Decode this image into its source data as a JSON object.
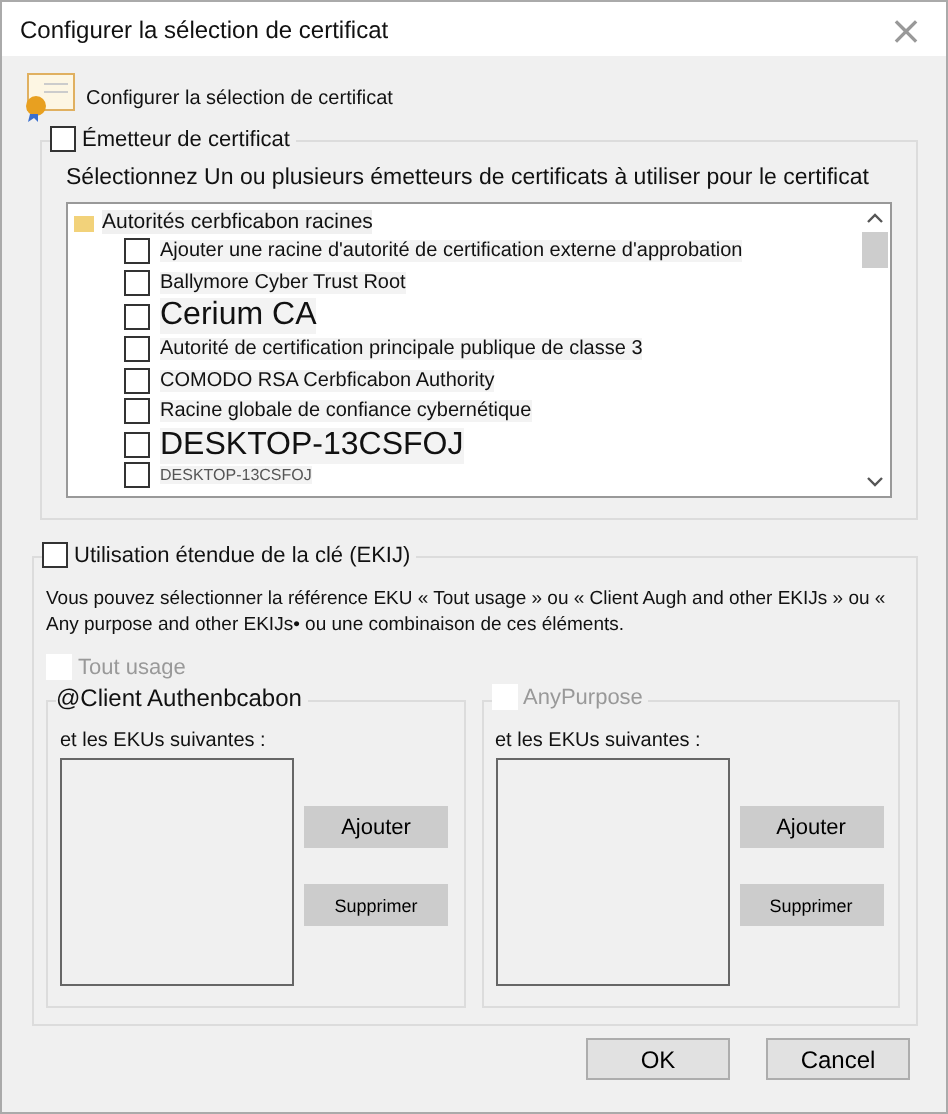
{
  "window": {
    "title": "Configurer la sélection de certificat",
    "close": "×"
  },
  "header": "Configurer la sélection de certificat",
  "issuer": {
    "label": "Émetteur de certificat",
    "checked": false,
    "description": "Sélectionnez Un ou plusieurs émetteurs de certificats à utiliser pour le certificat",
    "tree": {
      "label": "Autorités cerbficabon racines",
      "selected": true,
      "children": [
        {
          "label": "Ajouter une racine d'autorité de certification externe d'approbation",
          "checked": false,
          "kind": "normal"
        },
        {
          "label": "Ballymore Cyber Trust Root",
          "checked": false,
          "kind": "normal"
        },
        {
          "label": "Cerium CA",
          "checked": false,
          "kind": "large"
        },
        {
          "label": "Autorité de certification principale publique de classe 3",
          "checked": false,
          "kind": "normal"
        },
        {
          "label": "COMODO RSA Cerbficabon Authority",
          "checked": false,
          "kind": "normal"
        },
        {
          "label": "Racine globale de confiance cybernétique",
          "checked": false,
          "kind": "normal"
        },
        {
          "label": "DESKTOP-13CSFOJ",
          "checked": false,
          "kind": "large"
        },
        {
          "label": "DESKTOP-13CSFOJ",
          "checked": false,
          "kind": "small"
        }
      ]
    }
  },
  "eku": {
    "label": "Utilisation étendue de la clé (EKIJ)",
    "checked": false,
    "description": "Vous pouvez sélectionner la référence EKU « Tout usage » ou « Client Augh and other EKIJs » ou « Any purpose and other EKIJs• ou une combinaison de ces éléments.",
    "all_usage": {
      "label": "Tout usage",
      "checked": false,
      "disabled": true
    },
    "groups": [
      {
        "title": "@Client Authenbcabon",
        "kind": "label",
        "disabled": false,
        "list_label": "et les EKUs suivantes :",
        "buttons": [
          "Ajouter",
          "Supprimer"
        ]
      },
      {
        "title": "AnyPurpose",
        "kind": "checkbox",
        "checked": false,
        "disabled": true,
        "list_label": "et les EKUs suivantes :",
        "buttons": [
          "Ajouter",
          "Supprimer"
        ]
      }
    ]
  },
  "buttons": [
    "OK",
    "Cancel"
  ]
}
